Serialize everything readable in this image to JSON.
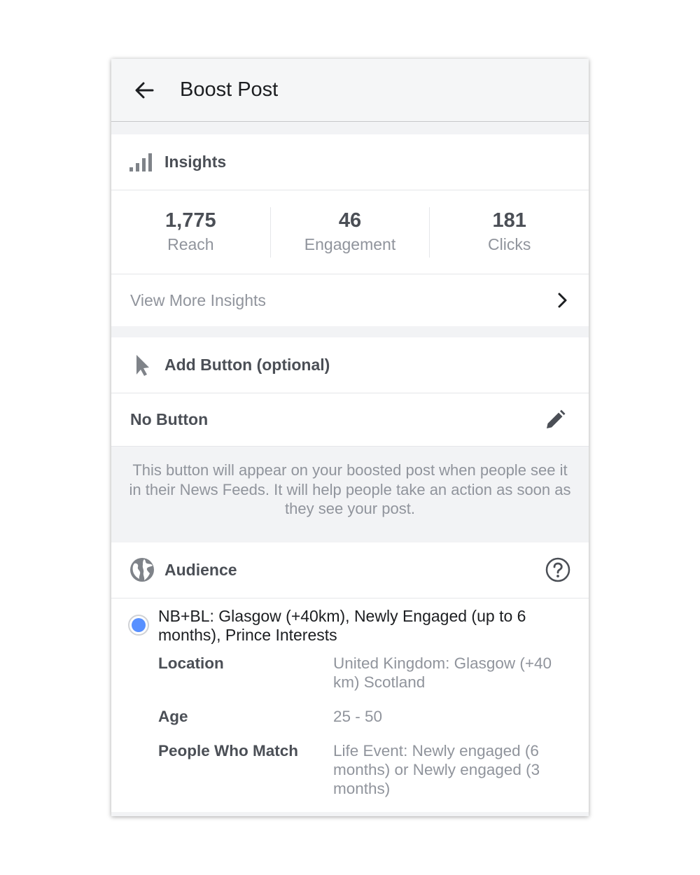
{
  "header": {
    "title": "Boost Post"
  },
  "insights": {
    "title": "Insights",
    "stats": [
      {
        "value": "1,775",
        "label": "Reach"
      },
      {
        "value": "46",
        "label": "Engagement"
      },
      {
        "value": "181",
        "label": "Clicks"
      }
    ],
    "view_more": "View More Insights"
  },
  "add_button": {
    "title": "Add Button (optional)",
    "current": "No Button",
    "hint": "This button will appear on your boosted post when people see it in their News Feeds. It will help people take an action as soon as they see your post."
  },
  "audience": {
    "title": "Audience",
    "option": {
      "name": "NB+BL: Glasgow (+40km), Newly Engaged (up to 6 months), Prince Interests",
      "selected": true,
      "details": [
        {
          "key": "Location",
          "value": "United Kingdom: Glasgow (+40 km) Scotland"
        },
        {
          "key": "Age",
          "value": "25 - 50"
        },
        {
          "key": "People Who Match",
          "value": "Life Event: Newly engaged (6 months) or Newly engaged (3 months)"
        }
      ]
    }
  },
  "colors": {
    "accent": "#5890ff",
    "text_primary": "#1c1e21",
    "text_secondary": "#4b4f56",
    "text_muted": "#90949c",
    "background": "#f2f3f5"
  },
  "icons": {
    "back": "arrow-left-icon",
    "insights": "signal-bars-icon",
    "chevron": "chevron-right-icon",
    "add_button": "cursor-pointer-icon",
    "edit": "pencil-icon",
    "audience": "globe-icon",
    "help": "question-circle-icon"
  }
}
